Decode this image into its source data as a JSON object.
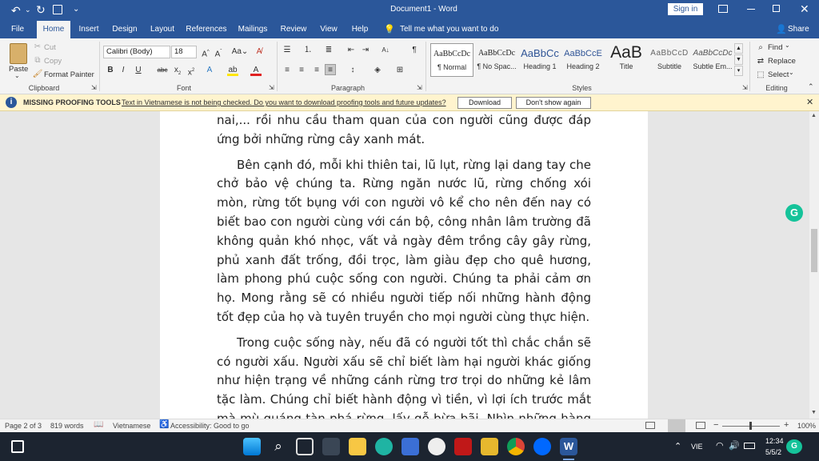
{
  "titlebar": {
    "title": "Document1  -  Word",
    "sign_in": "Sign in"
  },
  "tabs": [
    {
      "label": "File"
    },
    {
      "label": "Home"
    },
    {
      "label": "Insert"
    },
    {
      "label": "Design"
    },
    {
      "label": "Layout"
    },
    {
      "label": "References"
    },
    {
      "label": "Mailings"
    },
    {
      "label": "Review"
    },
    {
      "label": "View"
    },
    {
      "label": "Help"
    }
  ],
  "tell_me": "Tell me what you want to do",
  "share": "Share",
  "clipboard": {
    "paste": "Paste",
    "cut": "Cut",
    "copy": "Copy",
    "format_painter": "Format Painter",
    "group": "Clipboard"
  },
  "font": {
    "name": "Calibri (Body)",
    "size": "18",
    "group": "Font"
  },
  "paragraph": {
    "group": "Paragraph"
  },
  "styles": {
    "items": [
      {
        "preview": "AaBbCcDc",
        "name": "¶ Normal"
      },
      {
        "preview": "AaBbCcDc",
        "name": "¶ No Spac..."
      },
      {
        "preview": "AaBbCc",
        "name": "Heading 1"
      },
      {
        "preview": "AaBbCcE",
        "name": "Heading 2"
      },
      {
        "preview": "AaB",
        "name": "Title"
      },
      {
        "preview": "AaBbCcD",
        "name": "Subtitle"
      },
      {
        "preview": "AaBbCcDc",
        "name": "Subtle Em..."
      }
    ],
    "group": "Styles"
  },
  "editing": {
    "find": "Find",
    "replace": "Replace",
    "select": "Select",
    "group": "Editing"
  },
  "infobar": {
    "title": "MISSING PROOFING TOOLS",
    "message": "Text in Vietnamese is not being checked. Do you want to download proofing tools and future updates?",
    "download": "Download",
    "dont_show": "Don't show again"
  },
  "document": {
    "paragraphs": [
      "nai,... rồi nhu cầu tham quan của con người cũng được đáp ứng bởi những rừng cây xanh mát.",
      "Bên cạnh đó, mỗi khi thiên tai, lũ lụt, rừng lại dang tay che chở bảo vệ chúng ta. Rừng ngăn nước lũ, rừng chống xói mòn, rừng tốt bụng với con người vô kể cho nên đến nay có biết bao con người cùng với cán bộ, công nhân lâm trường đã không quản khó nhọc, vất vả ngày đêm trồng cây gây rừng, phủ xanh đất trống, đồi trọc, làm giàu đẹp cho quê hương, làm phong phú cuộc sống con người. Chúng ta phải cảm ơn họ. Mong rằng sẽ có nhiều người tiếp nối những hành động tốt đẹp của họ và tuyên truyền cho mọi người cùng thực hiện.",
      "Trong cuộc sống này, nếu đã có người tốt thì chắc chắn sẽ có người xấu. Người xấu sẽ chỉ biết làm hại người khác giống như hiện trạng về những cánh rừng trơ trọi do những kẻ lâm tặc làm. Chúng chỉ biết hành động vì tiền, vì lợi ích trước mắt mà mù quáng tàn phá rừng, lấy gỗ bừa bãi. Nhìn những hàng cây đổ"
    ]
  },
  "status": {
    "page": "Page 2 of 3",
    "words": "819 words",
    "language": "Vietnamese",
    "accessibility": "Accessibility: Good to go",
    "zoom": "100%"
  },
  "taskbar": {
    "lang": "VIE",
    "time": "12:34",
    "date": "5/5/2"
  },
  "colors": {
    "word_blue": "#2b579a",
    "infobar": "#fff4ce",
    "taskbar": "#1c2430",
    "grammarly": "#15c39a"
  }
}
